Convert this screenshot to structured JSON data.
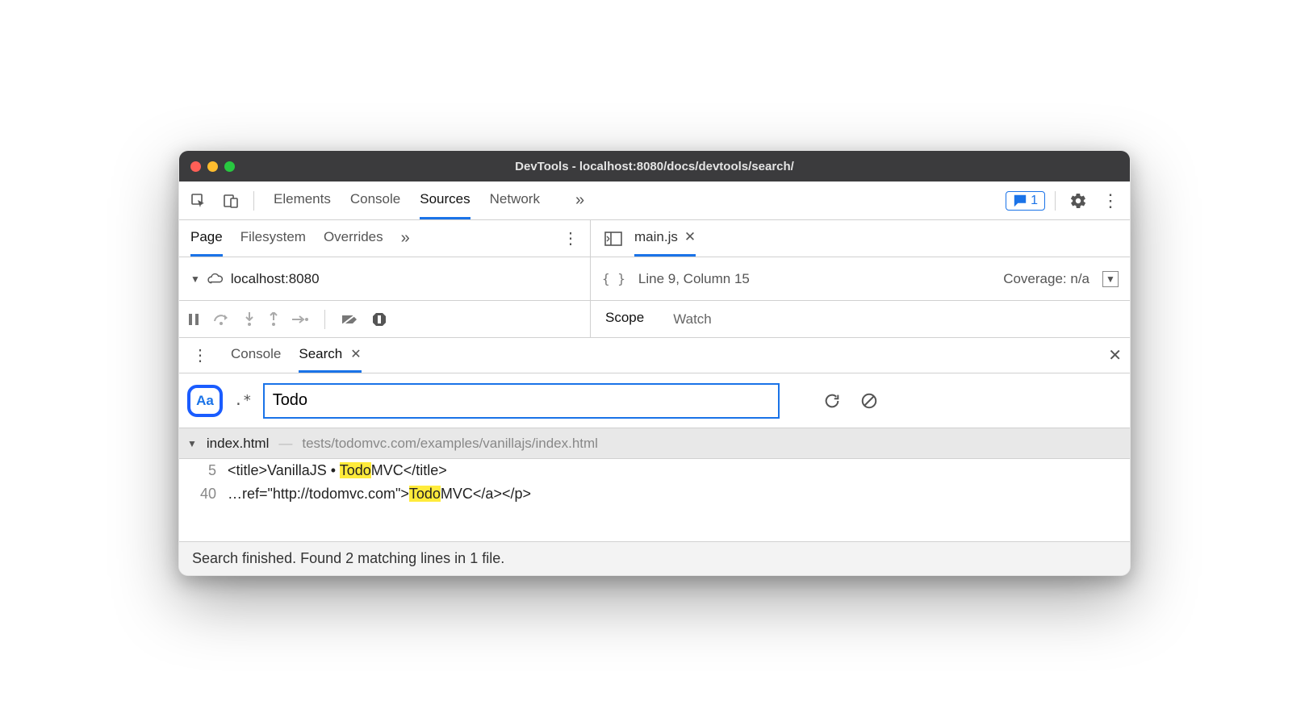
{
  "window": {
    "title": "DevTools - localhost:8080/docs/devtools/search/"
  },
  "main_tabs": {
    "elements": "Elements",
    "console": "Console",
    "sources": "Sources",
    "network": "Network",
    "more": "»"
  },
  "feedback_count": "1",
  "sources_panel": {
    "nav_tabs": {
      "page": "Page",
      "filesystem": "Filesystem",
      "overrides": "Overrides",
      "more": "»"
    },
    "tree": {
      "host": "localhost:8080"
    },
    "editor": {
      "open_file": "main.js",
      "cursor_status": "Line 9, Column 15",
      "coverage": "Coverage: n/a"
    },
    "debug_tabs": {
      "scope": "Scope",
      "watch": "Watch"
    }
  },
  "drawer": {
    "tabs": {
      "console": "Console",
      "search": "Search"
    }
  },
  "search": {
    "case_label": "Aa",
    "regex_label": ".*",
    "query": "Todo",
    "results": [
      {
        "file": "index.html",
        "path": "tests/todomvc.com/examples/vanillajs/index.html",
        "lines": [
          {
            "no": "5",
            "before": "<title>VanillaJS • ",
            "match": "Todo",
            "after": "MVC</title>"
          },
          {
            "no": "40",
            "before": "…ref=\"http://todomvc.com\">",
            "match": "Todo",
            "after": "MVC</a></p>"
          }
        ]
      }
    ],
    "status": "Search finished.  Found 2 matching lines in 1 file."
  }
}
